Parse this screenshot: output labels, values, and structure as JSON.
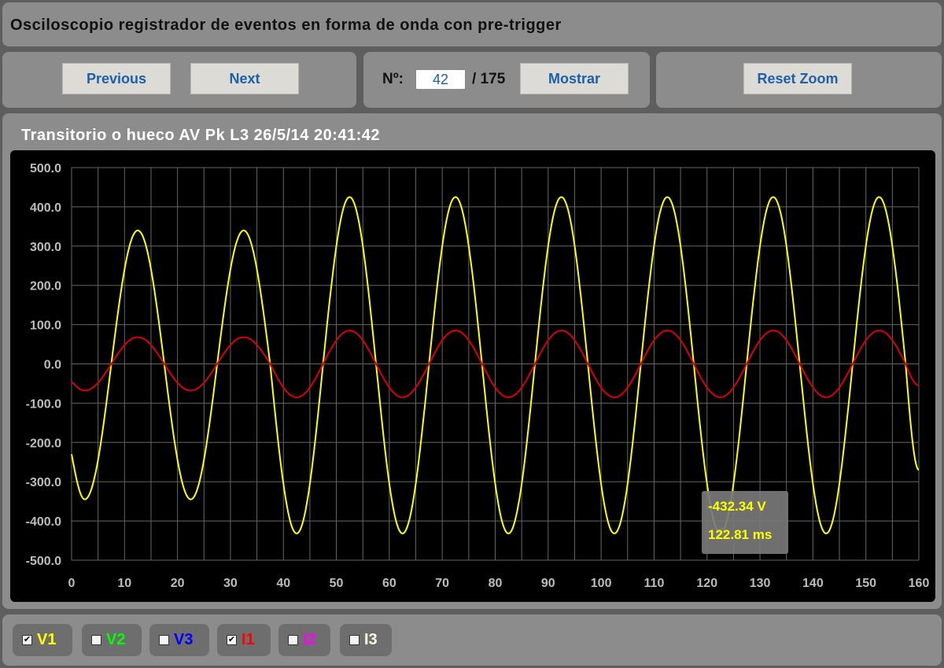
{
  "app": {
    "title": "Osciloscopio registrador de eventos en forma de onda con pre-trigger"
  },
  "toolbar": {
    "previous_label": "Previous",
    "next_label": "Next",
    "number_label": "Nº:",
    "number_value": "42",
    "total_label": "/ 175",
    "show_label": "Mostrar",
    "reset_zoom_label": "Reset Zoom"
  },
  "chart": {
    "title": "Transitorio o hueco AV Pk L3 26/5/14 20:41:42"
  },
  "tooltip": {
    "value": "-432.34 V",
    "time": "122.81 ms"
  },
  "legend": [
    {
      "label": "V1",
      "checked": true,
      "color": "#ffff00"
    },
    {
      "label": "V2",
      "checked": false,
      "color": "#00ff00"
    },
    {
      "label": "V3",
      "checked": false,
      "color": "#0000ff"
    },
    {
      "label": "I1",
      "checked": true,
      "color": "#ff0000"
    },
    {
      "label": "I2",
      "checked": false,
      "color": "#ff00ff"
    },
    {
      "label": "I3",
      "checked": false,
      "color": "#ffffe0"
    }
  ],
  "chart_data": {
    "type": "line",
    "title": "Transitorio o hueco AV Pk L3 26/5/14 20:41:42",
    "xlabel": "",
    "ylabel": "",
    "xlim": [
      0,
      160
    ],
    "ylim": [
      -500,
      500
    ],
    "x_ticks": [
      0,
      10,
      20,
      30,
      40,
      50,
      60,
      70,
      80,
      90,
      100,
      110,
      120,
      130,
      140,
      150,
      160
    ],
    "y_ticks": [
      "-500.0",
      "-400.0",
      "-300.0",
      "-200.0",
      "-100.0",
      "0.0",
      "100.0",
      "200.0",
      "300.0",
      "400.0",
      "500.0"
    ],
    "grid": true,
    "series": [
      {
        "name": "V1",
        "color": "#ffff00",
        "points": [
          [
            0,
            -230
          ],
          [
            2.5,
            -345
          ],
          [
            7.5,
            0
          ],
          [
            12.5,
            340
          ],
          [
            17.5,
            0
          ],
          [
            22.5,
            -345
          ],
          [
            27.5,
            0
          ],
          [
            32.5,
            340
          ],
          [
            37.5,
            0
          ],
          [
            42.5,
            -432
          ],
          [
            47.5,
            0
          ],
          [
            52.5,
            425
          ],
          [
            57.5,
            0
          ],
          [
            62.5,
            -432
          ],
          [
            67.5,
            0
          ],
          [
            72.5,
            425
          ],
          [
            77.5,
            0
          ],
          [
            82.5,
            -432
          ],
          [
            87.5,
            0
          ],
          [
            92.5,
            425
          ],
          [
            97.5,
            0
          ],
          [
            102.5,
            -432
          ],
          [
            107.5,
            0
          ],
          [
            112.5,
            425
          ],
          [
            117.5,
            0
          ],
          [
            122.5,
            -432
          ],
          [
            127.5,
            0
          ],
          [
            132.5,
            425
          ],
          [
            137.5,
            0
          ],
          [
            142.5,
            -432
          ],
          [
            147.5,
            0
          ],
          [
            152.5,
            425
          ],
          [
            157.5,
            0
          ],
          [
            160,
            -270
          ]
        ]
      },
      {
        "name": "I1",
        "color": "#dd0000",
        "points": [
          [
            0,
            -45
          ],
          [
            2.5,
            -68
          ],
          [
            7.5,
            0
          ],
          [
            12.5,
            68
          ],
          [
            17.5,
            0
          ],
          [
            22.5,
            -68
          ],
          [
            27.5,
            0
          ],
          [
            32.5,
            68
          ],
          [
            37.5,
            0
          ],
          [
            42.5,
            -85
          ],
          [
            47.5,
            0
          ],
          [
            52.5,
            85
          ],
          [
            57.5,
            0
          ],
          [
            62.5,
            -85
          ],
          [
            67.5,
            0
          ],
          [
            72.5,
            85
          ],
          [
            77.5,
            0
          ],
          [
            82.5,
            -85
          ],
          [
            87.5,
            0
          ],
          [
            92.5,
            85
          ],
          [
            97.5,
            0
          ],
          [
            102.5,
            -85
          ],
          [
            107.5,
            0
          ],
          [
            112.5,
            85
          ],
          [
            117.5,
            0
          ],
          [
            122.5,
            -85
          ],
          [
            127.5,
            0
          ],
          [
            132.5,
            85
          ],
          [
            137.5,
            0
          ],
          [
            142.5,
            -85
          ],
          [
            147.5,
            0
          ],
          [
            152.5,
            85
          ],
          [
            157.5,
            0
          ],
          [
            160,
            -55
          ]
        ]
      }
    ],
    "highlight_point": {
      "x": 122.81,
      "y": -432.34
    }
  }
}
